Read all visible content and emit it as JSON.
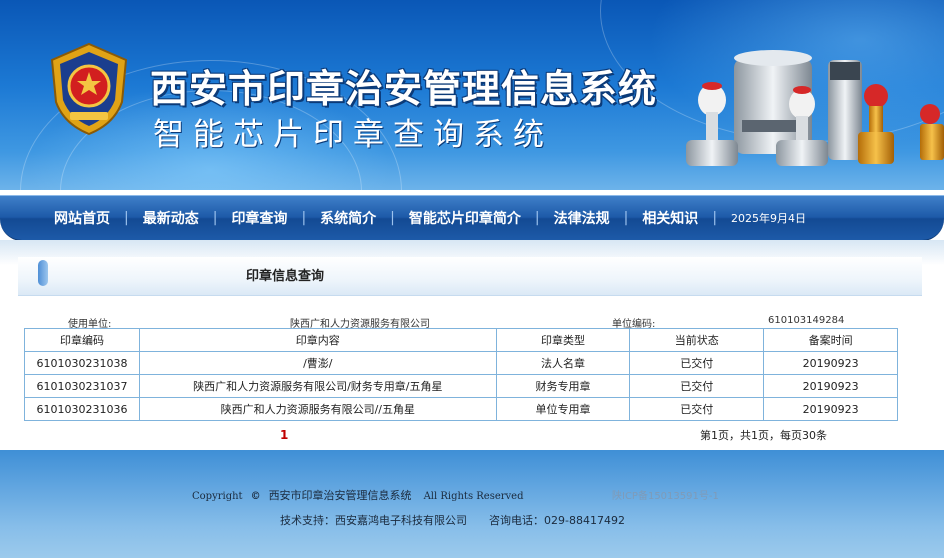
{
  "header": {
    "title": "西安市印章治安管理信息系统",
    "subtitle": "智能芯片印章查询系统",
    "brand_color": "#1c79d4"
  },
  "nav": {
    "items": [
      "网站首页",
      "最新动态",
      "印章查询",
      "系统简介",
      "智能芯片印章简介",
      "法律法规",
      "相关知识"
    ],
    "date": "2025年9月4日"
  },
  "query": {
    "title": "印章信息查询",
    "unit_label": "使用单位:",
    "unit_value": "陕西广和人力资源服务有限公司",
    "code_label": "单位编码:",
    "code_value": "610103149284"
  },
  "table": {
    "headers": [
      "印章编码",
      "印章内容",
      "印章类型",
      "当前状态",
      "备案时间"
    ],
    "rows": [
      [
        "6101030231038",
        "/曹澎/",
        "法人名章",
        "已交付",
        "20190923"
      ],
      [
        "6101030231037",
        "陕西广和人力资源服务有限公司/财务专用章/五角星",
        "财务专用章",
        "已交付",
        "20190923"
      ],
      [
        "6101030231036",
        "陕西广和人力资源服务有限公司//五角星",
        "单位专用章",
        "已交付",
        "20190923"
      ]
    ]
  },
  "pager": {
    "current": "1",
    "summary": "第1页，共1页，每页30条"
  },
  "footer": {
    "copyright_prefix": "Copyright",
    "copyright_symbol": "©",
    "copyright_name": "西安市印章治安管理信息系统",
    "rights": "All Rights Reserved",
    "icp": "陕ICP备15013591号-1",
    "support_label": "技术支持：",
    "support_value": "西安嘉鸿电子科技有限公司",
    "phone_label": "咨询电话：",
    "phone_value": "029-88417492"
  }
}
